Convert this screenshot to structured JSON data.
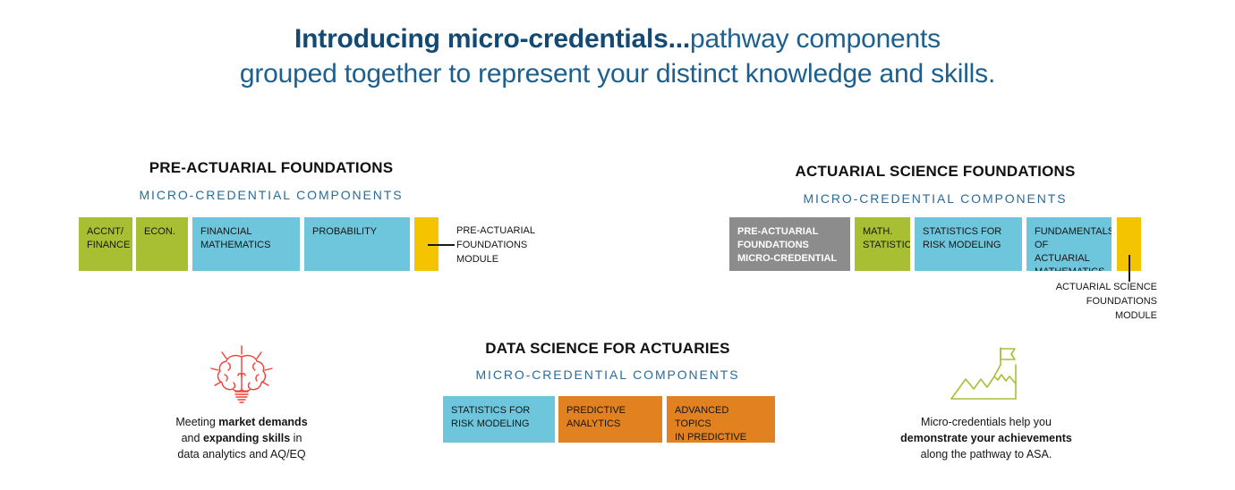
{
  "title": {
    "strong": "Introducing micro-credentials...",
    "normal": "pathway components",
    "line2": "grouped together to represent your distinct knowledge and skills.",
    "color_strong": "#134a74",
    "color_normal": "#1b608f"
  },
  "palette": {
    "green": "#a8bf34",
    "blue": "#6ec6dd",
    "yellow": "#f5c400",
    "gray": "#8c8c8c",
    "orange": "#e2811f",
    "heading_blue": "#2a6b9b",
    "icon_red": "#ef3e36",
    "icon_olive": "#a8bf34"
  },
  "subtitle_common": "MICRO-CREDENTIAL COMPONENTS",
  "sections": [
    {
      "id": "pre-actuarial-foundations",
      "title": "PRE-ACTUARIAL FOUNDATIONS",
      "subtitle": "MICRO-CREDENTIAL COMPONENTS",
      "blocks": [
        {
          "label": "ACCNT/\nFINANCE",
          "color": "green"
        },
        {
          "label": "ECON.",
          "color": "green"
        },
        {
          "label": "FINANCIAL\nMATHEMATICS",
          "color": "blue"
        },
        {
          "label": "PROBABILITY",
          "color": "blue"
        },
        {
          "label": "",
          "color": "yellow"
        }
      ],
      "module_label": "PRE-ACTUARIAL\nFOUNDATIONS\nMODULE"
    },
    {
      "id": "actuarial-science-foundations",
      "title": "ACTUARIAL SCIENCE FOUNDATIONS",
      "subtitle": "MICRO-CREDENTIAL COMPONENTS",
      "blocks": [
        {
          "label": "PRE-ACTUARIAL\nFOUNDATIONS\nMICRO-CREDENTIAL",
          "color": "gray"
        },
        {
          "label": "MATH.\nSTATISTICS",
          "color": "green"
        },
        {
          "label": "STATISTICS FOR\nRISK MODELING",
          "color": "blue"
        },
        {
          "label": "FUNDAMENTALS\nOF ACTUARIAL\nMATHEMATICS",
          "color": "blue"
        },
        {
          "label": "",
          "color": "yellow"
        }
      ],
      "module_label": "ACTUARIAL SCIENCE\nFOUNDATIONS\nMODULE"
    },
    {
      "id": "data-science-for-actuaries",
      "title": "DATA SCIENCE FOR ACTUARIES",
      "subtitle": "MICRO-CREDENTIAL COMPONENTS",
      "blocks": [
        {
          "label": "STATISTICS FOR\nRISK MODELING",
          "color": "blue"
        },
        {
          "label": "PREDICTIVE\nANALYTICS",
          "color": "orange"
        },
        {
          "label": "ADVANCED TOPICS\nIN PREDICTIVE\nANALYTICS",
          "color": "orange"
        }
      ],
      "module_label": ""
    }
  ],
  "callouts": [
    {
      "id": "market-demands",
      "icon": "brain-lightbulb-icon",
      "lines": [
        {
          "text": "Meeting ",
          "bold": false
        },
        {
          "text": "market demands",
          "bold": true
        },
        {
          "text": "and ",
          "bold": false
        },
        {
          "text": "expanding skills",
          "bold": true
        },
        {
          "text": " in",
          "bold": false
        },
        {
          "text": "data analytics and AQ/EQ",
          "bold": false
        }
      ],
      "line1_plain": "Meeting ",
      "line1_bold": "market demands",
      "line2_plain_a": "and ",
      "line2_bold": "expanding skills",
      "line2_plain_b": " in",
      "line3": "data analytics and AQ/EQ"
    },
    {
      "id": "demonstrate-achievements",
      "icon": "mountain-flag-icon",
      "line1": "Micro-credentials help you",
      "line2_bold": "demonstrate your achievements",
      "line3": "along the pathway to ASA."
    }
  ]
}
